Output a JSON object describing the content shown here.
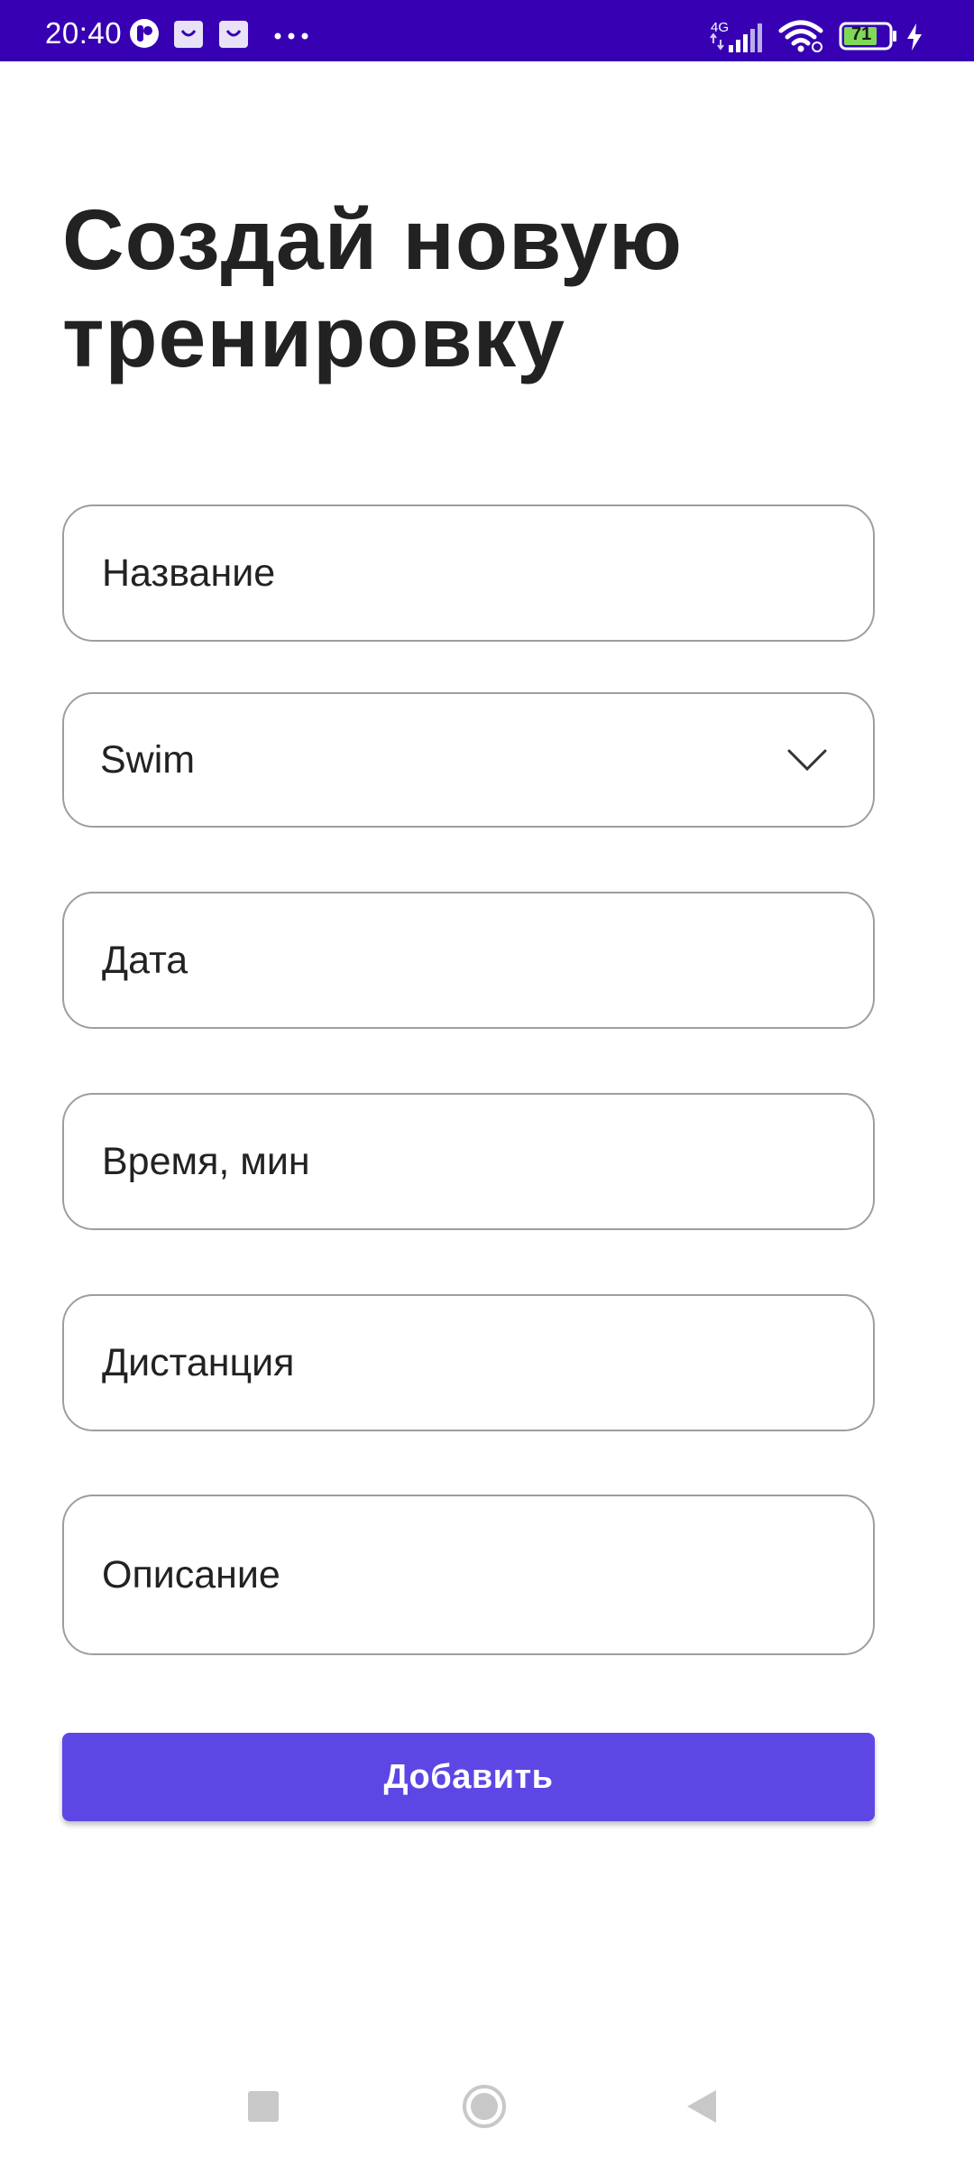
{
  "status_bar": {
    "time": "20:40",
    "network": "4G",
    "battery": "71",
    "icons": [
      "notification-app-icon",
      "shopping-bag-icon",
      "shopping-bag-icon",
      "more-dots-icon",
      "signal-icon",
      "wifi-icon",
      "battery-icon",
      "charging-icon"
    ],
    "background_color": "#3700b3"
  },
  "page": {
    "title": "Создай новую тренировку"
  },
  "form": {
    "name_placeholder": "Название",
    "sport_selected": "Swim",
    "date_placeholder": "Дата",
    "time_placeholder": "Время, мин",
    "distance_placeholder": "Дистанция",
    "description_placeholder": "Описание"
  },
  "actions": {
    "add_label": "Добавить",
    "accent_color": "#5c47e5"
  },
  "nav_bar": {
    "icons": [
      "recents-square-icon",
      "home-circle-icon",
      "back-triangle-icon"
    ]
  }
}
